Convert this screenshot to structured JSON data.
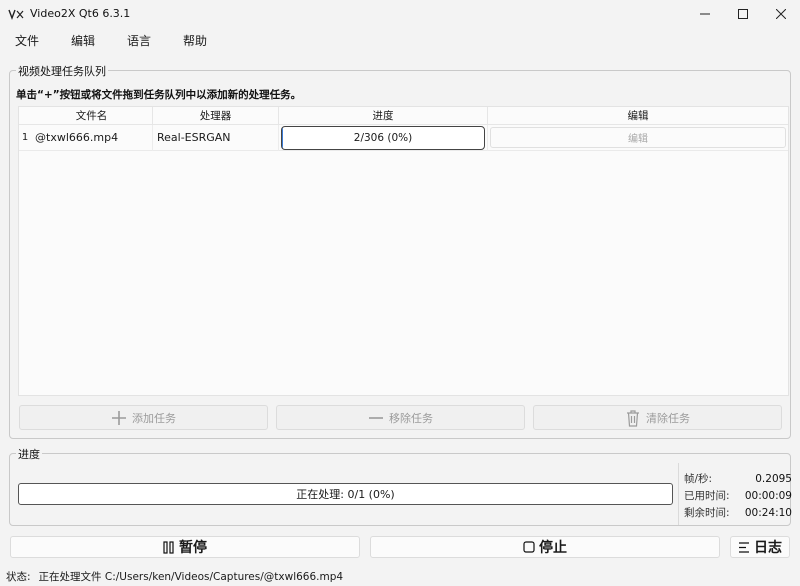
{
  "window": {
    "title": "Video2X Qt6 6.3.1"
  },
  "menu": [
    "文件",
    "编辑",
    "语言",
    "帮助"
  ],
  "queue": {
    "group_title": "视频处理任务队列",
    "hint": "单击“+”按钮或将文件拖到任务队列中以添加新的处理任务。",
    "columns": [
      "文件名",
      "处理器",
      "进度",
      "编辑"
    ],
    "rows": [
      {
        "index": "1",
        "filename": "@txwl666.mp4",
        "processor": "Real-ESRGAN",
        "progress_text": "2/306 (0%)",
        "progress_fraction": 0.0065,
        "edit_label": "编辑"
      }
    ],
    "add_label": "添加任务",
    "remove_label": "移除任务",
    "clear_label": "清除任务"
  },
  "progress": {
    "group_title": "进度",
    "overall_text": "正在处理: 0/1 (0%)",
    "overall_fraction": 0.0,
    "stats": [
      {
        "label": "帧/秒:",
        "value": "0.2095"
      },
      {
        "label": "已用时间:",
        "value": "00:00:09"
      },
      {
        "label": "剩余时间:",
        "value": "00:24:10"
      }
    ]
  },
  "controls": {
    "pause_label": "暂停",
    "stop_label": "停止",
    "log_label": "日志"
  },
  "status": {
    "label": "状态:",
    "text": "正在处理文件 C:/Users/ken/Videos/Captures/@txwl666.mp4"
  },
  "colors": {
    "accent": "#3a7bd5",
    "background": "#f3f3f3",
    "disabled_text": "#9b9b9b"
  }
}
